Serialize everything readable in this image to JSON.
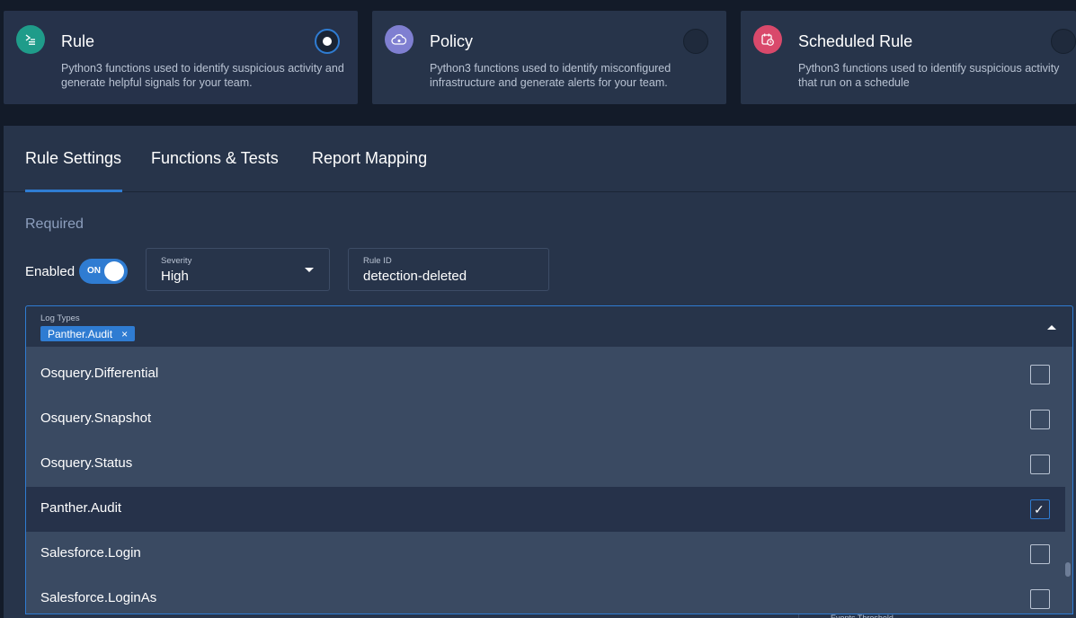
{
  "detection_types": [
    {
      "title": "Rule",
      "description": "Python3 functions used to identify suspicious activity and generate helpful signals for your team.",
      "icon": "terminal-icon",
      "color": "#1f9c8a",
      "selected": true
    },
    {
      "title": "Policy",
      "description": "Python3 functions used to identify misconfigured infrastructure and generate alerts for your team.",
      "icon": "cloud-icon",
      "color": "#7f7fd1",
      "selected": false
    },
    {
      "title": "Scheduled Rule",
      "description": "Python3 functions used to identify suspicious activity that run on a schedule",
      "icon": "calendar-clock-icon",
      "color": "#d9496b",
      "selected": false
    }
  ],
  "tabs": [
    "Rule Settings",
    "Functions & Tests",
    "Report Mapping"
  ],
  "active_tab": "Rule Settings",
  "form": {
    "required_label": "Required",
    "enabled_label": "Enabled",
    "toggle_text": "ON",
    "severity": {
      "label": "Severity",
      "value": "High"
    },
    "rule_id": {
      "label": "Rule ID",
      "value": "detection-deleted"
    },
    "log_types": {
      "label": "Log Types",
      "chips": [
        "Panther.Audit"
      ],
      "chip_remove": "×",
      "options": [
        {
          "label": "Osquery.Differential",
          "checked": false
        },
        {
          "label": "Osquery.Snapshot",
          "checked": false
        },
        {
          "label": "Osquery.Status",
          "checked": false
        },
        {
          "label": "Panther.Audit",
          "checked": true
        },
        {
          "label": "Salesforce.Login",
          "checked": false
        },
        {
          "label": "Salesforce.LoginAs",
          "checked": false
        }
      ]
    },
    "events_threshold_label": "Events Threshold"
  },
  "colors": {
    "accent": "#2f7cd2",
    "panel": "#27344a",
    "background": "#131b29",
    "dropdown": "#3a4a62"
  }
}
